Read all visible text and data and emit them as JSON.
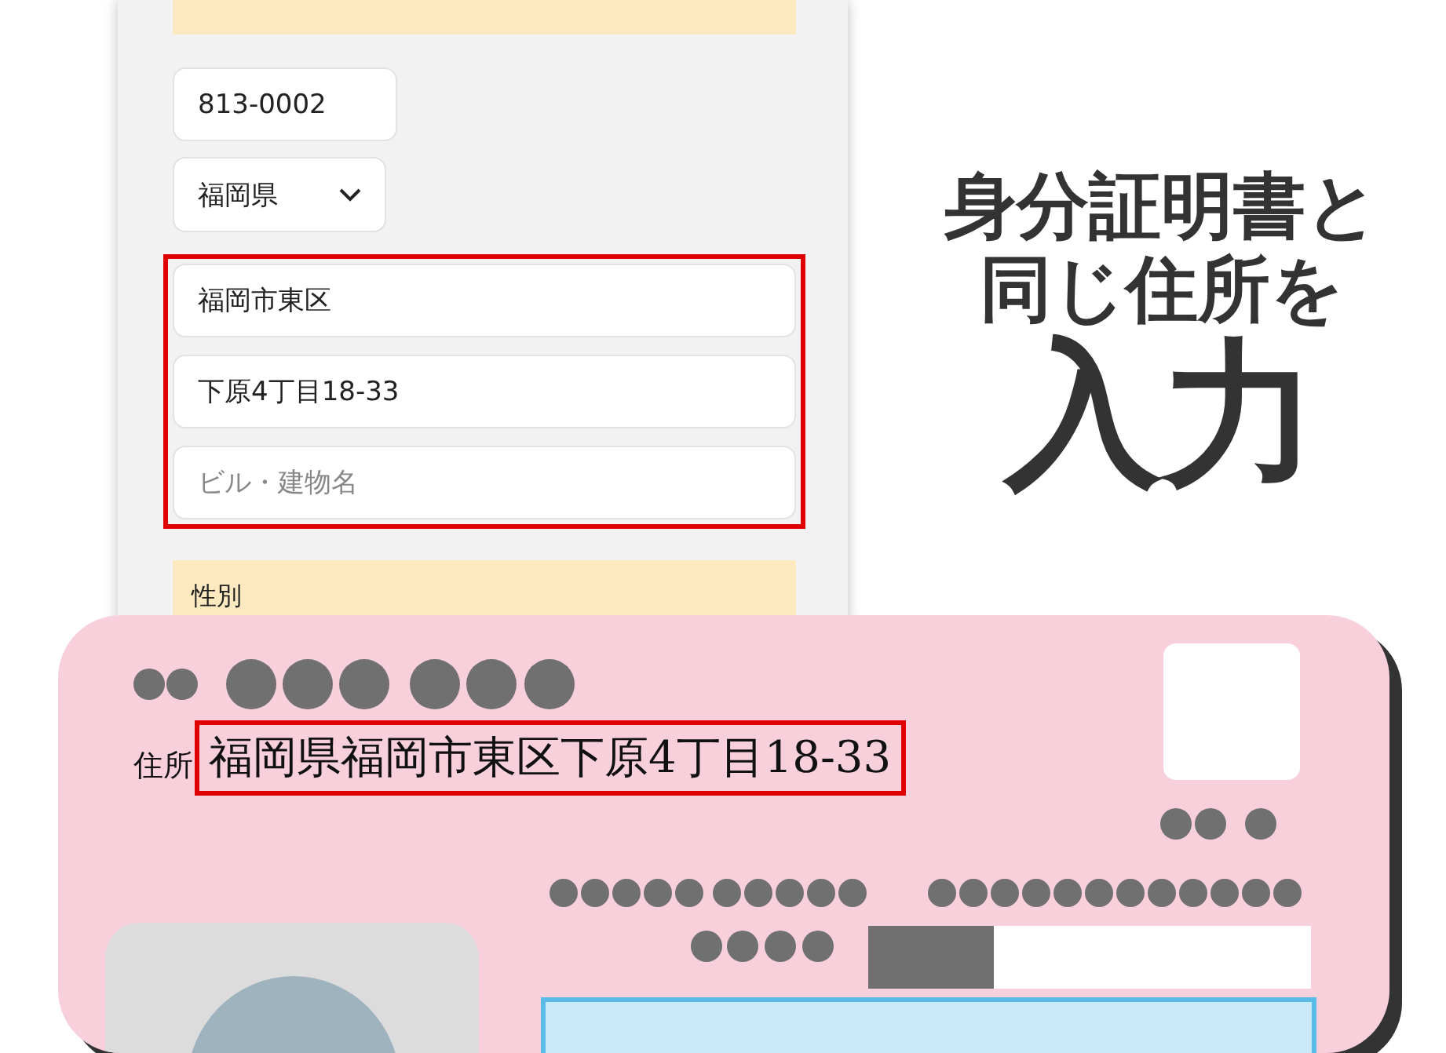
{
  "form": {
    "fields": [
      {
        "kind": "text",
        "value": "813-0002"
      },
      {
        "kind": "select",
        "value": "福岡県"
      }
    ],
    "highlighted_fields": [
      {
        "kind": "text",
        "value": "福岡市東区"
      },
      {
        "kind": "text",
        "value": "下原4丁目18-33"
      },
      {
        "kind": "text",
        "placeholder": "ビル・建物名"
      }
    ],
    "next_section": {
      "label": "性別"
    }
  },
  "headline": [
    {
      "kind": "normal",
      "text": "身分証明書と"
    },
    {
      "kind": "normal",
      "text": "同じ住所を"
    },
    {
      "kind": "large",
      "text": "入力"
    }
  ],
  "id_card": {
    "address_label": "住所",
    "address": "福岡県福岡市東区下原4丁目18-33"
  }
}
